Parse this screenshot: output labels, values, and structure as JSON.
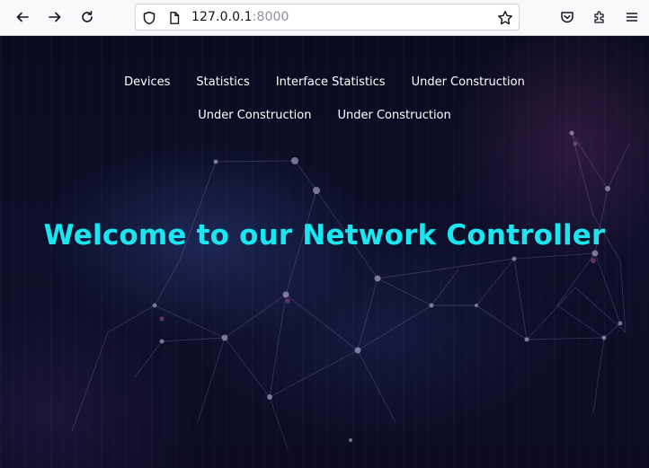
{
  "browser": {
    "url_host": "127.0.0.1",
    "url_port": ":8000",
    "icons": [
      "back-arrow-icon",
      "forward-arrow-icon",
      "reload-icon",
      "shield-icon",
      "page-icon",
      "star-icon",
      "pocket-icon",
      "extensions-icon",
      "menu-icon"
    ]
  },
  "nav": {
    "row1": [
      "Devices",
      "Statistics",
      "Interface Statistics",
      "Under Construction"
    ],
    "row2": [
      "Under Construction",
      "Under Construction"
    ]
  },
  "hero": {
    "title": "Welcome to our Network Controller",
    "title_color": "#19e6f0"
  },
  "colors": {
    "background": "#0b0b1e",
    "nav_text": "#ffffff"
  }
}
